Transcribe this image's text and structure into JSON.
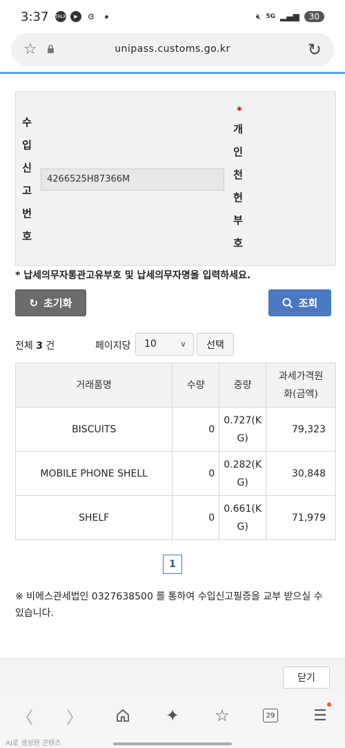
{
  "status": {
    "time": "3:37",
    "battery": "30",
    "network": "5G"
  },
  "browser": {
    "url": "unipass.customs.go.kr",
    "tab_count": "29",
    "ai_label": "AI로 생성한 콘텐츠"
  },
  "form": {
    "import_label_chars": [
      "수",
      "입",
      "신",
      "고",
      "번",
      "호"
    ],
    "personal_label_chars": [
      "개",
      "인",
      "천",
      "헌",
      "부",
      "호"
    ],
    "required_mark": "*",
    "import_number_value": "4266525H87366M",
    "notice": "* 납세의무자통관고유부호 및 납세의무자명을 입력하세요."
  },
  "buttons": {
    "reset": "초기화",
    "search": "조회",
    "select": "선택",
    "close": "닫기"
  },
  "list": {
    "total_prefix": "전체",
    "total_count": "3",
    "total_suffix": "건",
    "per_page_label": "페이지당",
    "per_page_value": "10"
  },
  "table": {
    "headers": {
      "name": "거래품명",
      "qty": "수량",
      "weight": "중량",
      "price_line1": "과세가격원",
      "price_line2": "화(금액)"
    },
    "rows": [
      {
        "name": "BISCUITS",
        "qty": "0",
        "weight_line1": "0.727(K",
        "weight_line2": "G)",
        "price": "79,323"
      },
      {
        "name": "MOBILE PHONE SHELL",
        "qty": "0",
        "weight_line1": "0.282(K",
        "weight_line2": "G)",
        "price": "30,848"
      },
      {
        "name": "SHELF",
        "qty": "0",
        "weight_line1": "0.661(K",
        "weight_line2": "G)",
        "price": "71,979"
      }
    ]
  },
  "pagination": {
    "current": "1"
  },
  "footnote": "※ 비에스관세법인 0327638500 를 통하여 수입신고필증을 교부 받으실 수 있습니다."
}
